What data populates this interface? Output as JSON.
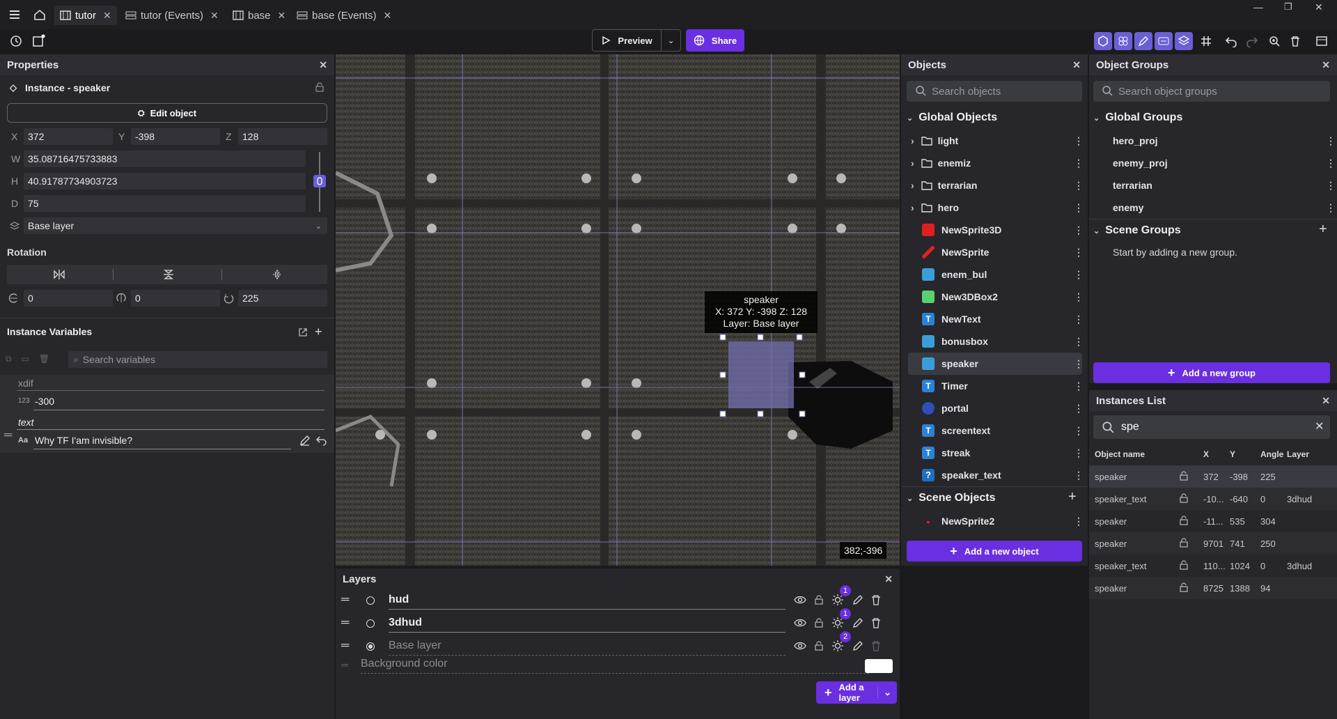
{
  "tabs": [
    {
      "label": "tutor"
    },
    {
      "label": "tutor (Events)"
    },
    {
      "label": "base"
    },
    {
      "label": "base (Events)"
    }
  ],
  "toolbar": {
    "preview_label": "Preview",
    "share_label": "Share"
  },
  "properties": {
    "title": "Properties",
    "instance_label": "Instance  -  speaker",
    "edit_object_label": "Edit object",
    "x_label": "X",
    "x": "372",
    "y_label": "Y",
    "y": "-398",
    "z_label": "Z",
    "z": "128",
    "w_label": "W",
    "w": "35.08716475733883",
    "h_label": "H",
    "h": "40.91787734903723",
    "d_label": "D",
    "d": "75",
    "layer": "Base layer",
    "rotation_label": "Rotation",
    "rot_x": "0",
    "rot_y": "0",
    "rot_z": "225",
    "instance_variables_label": "Instance Variables",
    "search_variables_placeholder": "Search variables",
    "var1_name": "xdif",
    "var1_type": "123",
    "var1_value": "-300",
    "var2_name": "text",
    "var2_type": "Aa",
    "var2_value": "Why TF I'am invisible?"
  },
  "canvas": {
    "tooltip_name": "speaker",
    "tooltip_coords": "X: 372  Y: -398  Z: 128",
    "tooltip_layer": "Layer: Base layer",
    "cursor_coords": "382;-396"
  },
  "objects": {
    "title": "Objects",
    "search_placeholder": "Search objects",
    "global_label": "Global Objects",
    "global_items": [
      {
        "label": "light",
        "kind": "folder"
      },
      {
        "label": "enemiz",
        "kind": "folder"
      },
      {
        "label": "terrarian",
        "kind": "folder"
      },
      {
        "label": "hero",
        "kind": "folder"
      },
      {
        "label": "NewSprite3D",
        "kind": "red"
      },
      {
        "label": "NewSprite",
        "kind": "dots"
      },
      {
        "label": "enem_bul",
        "kind": "blue"
      },
      {
        "label": "New3DBox2",
        "kind": "green"
      },
      {
        "label": "NewText",
        "kind": "text"
      },
      {
        "label": "bonusbox",
        "kind": "blue"
      },
      {
        "label": "speaker",
        "kind": "blue"
      },
      {
        "label": "Timer",
        "kind": "text"
      },
      {
        "label": "portal",
        "kind": "orb"
      },
      {
        "label": "screentext",
        "kind": "text"
      },
      {
        "label": "streak",
        "kind": "text"
      },
      {
        "label": "speaker_text",
        "kind": "question"
      }
    ],
    "scene_label": "Scene Objects",
    "scene_items": [
      {
        "label": "NewSprite2"
      }
    ],
    "add_label": "Add a new object"
  },
  "object_groups": {
    "title": "Object Groups",
    "search_placeholder": "Search object groups",
    "global_label": "Global Groups",
    "global_items": [
      "hero_proj",
      "enemy_proj",
      "terrarian",
      "enemy"
    ],
    "scene_label": "Scene Groups",
    "empty_text": "Start by adding a new group.",
    "add_label": "Add a new group"
  },
  "instances": {
    "title": "Instances List",
    "search_value": "spe",
    "headers": [
      "Object name",
      "X",
      "Y",
      "Angle",
      "Layer"
    ],
    "rows": [
      [
        "speaker",
        "372",
        "-398",
        "225",
        ""
      ],
      [
        "speaker_text",
        "-10...",
        "-640",
        "0",
        "3dhud"
      ],
      [
        "speaker",
        "-11...",
        "535",
        "304",
        ""
      ],
      [
        "speaker",
        "9701",
        "741",
        "250",
        ""
      ],
      [
        "speaker_text",
        "110...",
        "1024",
        "0",
        "3dhud"
      ],
      [
        "speaker",
        "8725",
        "1388",
        "94",
        ""
      ]
    ]
  },
  "layers": {
    "title": "Layers",
    "items": [
      {
        "name": "hud",
        "badge": "1"
      },
      {
        "name": "3dhud",
        "badge": "1"
      },
      {
        "name": "Base layer",
        "badge": "2"
      }
    ],
    "background_label": "Background color",
    "add_label": "Add a layer"
  },
  "colors": {
    "accent": "#6a2fe0",
    "selection": "#6e6aa8"
  }
}
